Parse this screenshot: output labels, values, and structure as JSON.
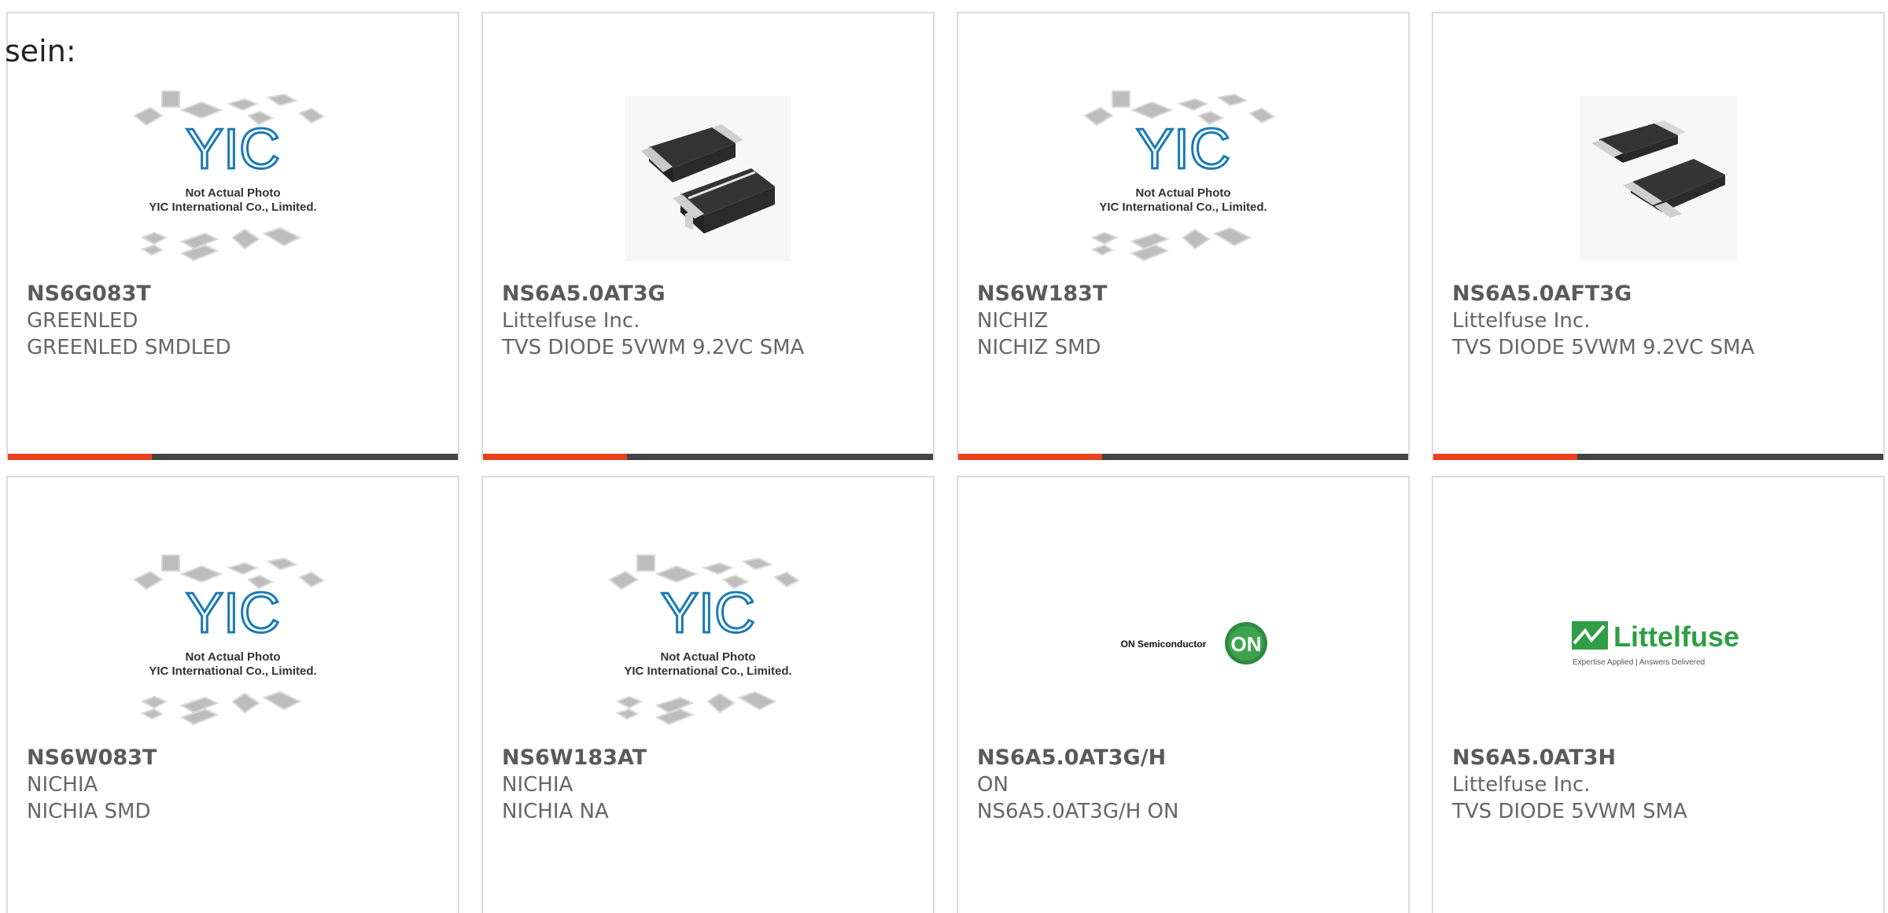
{
  "intro_text": "sein:",
  "colors": {
    "accent": "#e8411e",
    "bar": "#444444",
    "card_border": "#dcdcdc",
    "brand_blue": "#1a7ab5",
    "on_green": "#2e8b3e",
    "littelfuse_green": "#2f9e45"
  },
  "placeholder": {
    "brand": "YIC",
    "line1": "Not Actual Photo",
    "line2": "YIC International Co., Limited."
  },
  "on_logo": {
    "wordmark": "ON Semiconductor",
    "badge": "ON"
  },
  "littelfuse_logo": {
    "wordmark": "Littelfuse",
    "tagline": "Expertise Applied | Answers Delivered"
  },
  "products": [
    {
      "part": "NS6G083T",
      "manufacturer": "GREENLED",
      "description": "GREENLED SMDLED",
      "image": "placeholder"
    },
    {
      "part": "NS6A5.0AT3G",
      "manufacturer": "Littelfuse Inc.",
      "description": "TVS DIODE 5VWM 9.2VC SMA",
      "image": "sma-photo"
    },
    {
      "part": "NS6W183T",
      "manufacturer": "NICHIZ",
      "description": "NICHIZ SMD",
      "image": "placeholder"
    },
    {
      "part": "NS6A5.0AFT3G",
      "manufacturer": "Littelfuse Inc.",
      "description": "TVS DIODE 5VWM 9.2VC SMA",
      "image": "smaf-photo"
    },
    {
      "part": "NS6W083T",
      "manufacturer": "NICHIA",
      "description": "NICHIA SMD",
      "image": "placeholder"
    },
    {
      "part": "NS6W183AT",
      "manufacturer": "NICHIA",
      "description": "NICHIA NA",
      "image": "placeholder"
    },
    {
      "part": "NS6A5.0AT3G/H",
      "manufacturer": "ON",
      "description": "NS6A5.0AT3G/H ON",
      "image": "on-logo"
    },
    {
      "part": "NS6A5.0AT3H",
      "manufacturer": "Littelfuse Inc.",
      "description": "TVS DIODE 5VWM SMA",
      "image": "littelfuse-logo"
    }
  ]
}
